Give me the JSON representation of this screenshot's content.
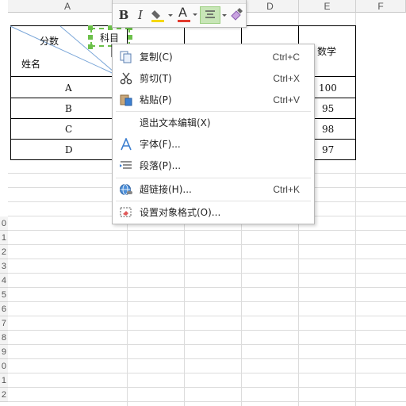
{
  "columns": [
    "A",
    "",
    "",
    "D",
    "E",
    "F"
  ],
  "row_numbers": [
    "0",
    "1",
    "2",
    "3",
    "4",
    "5",
    "6",
    "7",
    "8",
    "9",
    "0",
    "1",
    "2"
  ],
  "table": {
    "header_left_top": "分数",
    "header_left_bottom": "姓名",
    "header_subject": "科目",
    "header_math": "数学",
    "rows": [
      {
        "name": "A",
        "score": "100"
      },
      {
        "name": "B",
        "score": "95"
      },
      {
        "name": "C",
        "score": "98"
      },
      {
        "name": "D",
        "score": "97"
      }
    ]
  },
  "toolbar": {
    "bold": "B",
    "italic": "I",
    "font_color": "A",
    "highlight_color": "#f5d800",
    "font_color_bar": "#e23b2e",
    "active_bg": "#c8e6b7"
  },
  "menu": {
    "items": [
      {
        "label": "复制(C)",
        "shortcut": "Ctrl+C",
        "icon": "copy-icon"
      },
      {
        "label": "剪切(T)",
        "shortcut": "Ctrl+X",
        "icon": "scissors-icon"
      },
      {
        "label": "粘贴(P)",
        "shortcut": "Ctrl+V",
        "icon": "paste-icon"
      },
      {
        "label": "退出文本编辑(X)",
        "shortcut": "",
        "icon": ""
      },
      {
        "label": "字体(F)...",
        "shortcut": "",
        "icon": "font-icon"
      },
      {
        "label": "段落(P)...",
        "shortcut": "",
        "icon": "paragraph-icon"
      },
      {
        "label": "超链接(H)...",
        "shortcut": "Ctrl+K",
        "icon": "hyperlink-icon"
      },
      {
        "label": "设置对象格式(O)...",
        "shortcut": "",
        "icon": "format-object-icon"
      }
    ]
  }
}
